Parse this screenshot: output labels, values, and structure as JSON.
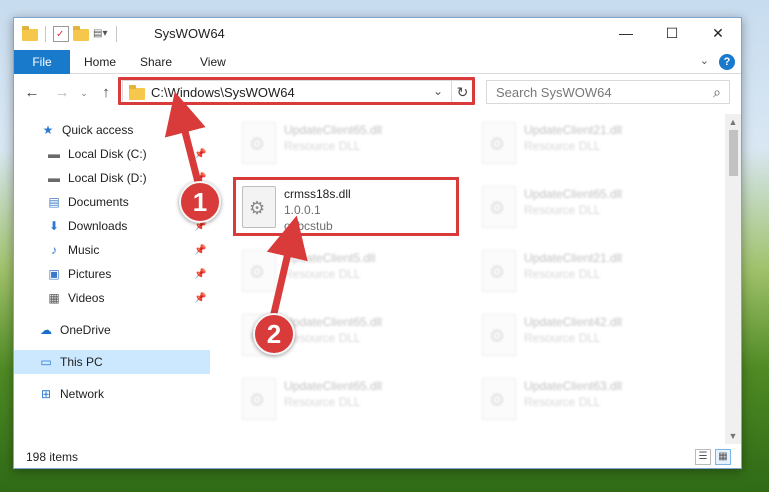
{
  "window": {
    "title": "SysWOW64",
    "controls": {
      "minimize": "—",
      "maximize": "☐",
      "close": "✕"
    }
  },
  "ribbon": {
    "tabs": [
      "File",
      "Home",
      "Share",
      "View"
    ],
    "expand_glyph": "⌄",
    "help_glyph": "?"
  },
  "navbar": {
    "address": "C:\\Windows\\SysWOW64",
    "search_placeholder": "Search SysWOW64"
  },
  "sidebar": {
    "items": [
      {
        "label": "Quick access",
        "icon": "star-icon",
        "glyph": "★",
        "color": "#2b79d0"
      },
      {
        "label": "Local Disk (C:)",
        "icon": "drive-icon",
        "glyph": "▬",
        "color": "#6a6a6a",
        "pinned": true
      },
      {
        "label": "Local Disk (D:)",
        "icon": "drive-icon",
        "glyph": "▬",
        "color": "#6a6a6a",
        "pinned": true
      },
      {
        "label": "Documents",
        "icon": "documents-icon",
        "glyph": "▤",
        "color": "#3c78c8",
        "pinned": true
      },
      {
        "label": "Downloads",
        "icon": "downloads-icon",
        "glyph": "⬇",
        "color": "#2b79d0",
        "pinned": true
      },
      {
        "label": "Music",
        "icon": "music-icon",
        "glyph": "♪",
        "color": "#2b79d0",
        "pinned": true
      },
      {
        "label": "Pictures",
        "icon": "pictures-icon",
        "glyph": "▣",
        "color": "#3c78c8",
        "pinned": true
      },
      {
        "label": "Videos",
        "icon": "videos-icon",
        "glyph": "▦",
        "color": "#555555",
        "pinned": true
      },
      {
        "label": "OneDrive",
        "icon": "cloud-icon",
        "glyph": "☁",
        "color": "#1a6fc9"
      },
      {
        "label": "This PC",
        "icon": "computer-icon",
        "glyph": "🖥",
        "color": "#2b79d0",
        "selected": true
      },
      {
        "label": "Network",
        "icon": "network-icon",
        "glyph": "⊞",
        "color": "#2b79d0"
      }
    ]
  },
  "files": {
    "left_column": [
      {
        "name": "UpdateClient65.dll",
        "meta1": "Resource DLL"
      },
      {
        "name": "crmss18s.dll",
        "meta1": "1.0.0.1",
        "meta2": "odbcstub",
        "highlighted": true
      },
      {
        "name": "UpdateClient5.dll",
        "meta1": "Resource DLL"
      },
      {
        "name": "UpdateClient65.dll",
        "meta1": "Resource DLL"
      },
      {
        "name": "UpdateClient65.dll",
        "meta1": "Resource DLL"
      }
    ],
    "right_column": [
      {
        "name": "UpdateClient21.dll",
        "meta1": "Resource DLL"
      },
      {
        "name": "UpdateClient65.dll",
        "meta1": "Resource DLL"
      },
      {
        "name": "UpdateClient21.dll",
        "meta1": "Resource DLL"
      },
      {
        "name": "UpdateClient42.dll",
        "meta1": "Resource DLL"
      },
      {
        "name": "UpdateClient63.dll",
        "meta1": "Resource DLL"
      }
    ]
  },
  "status": {
    "item_count": "198 items"
  },
  "annotations": {
    "badge1": "1",
    "badge2": "2",
    "color": "#d93a3a"
  }
}
